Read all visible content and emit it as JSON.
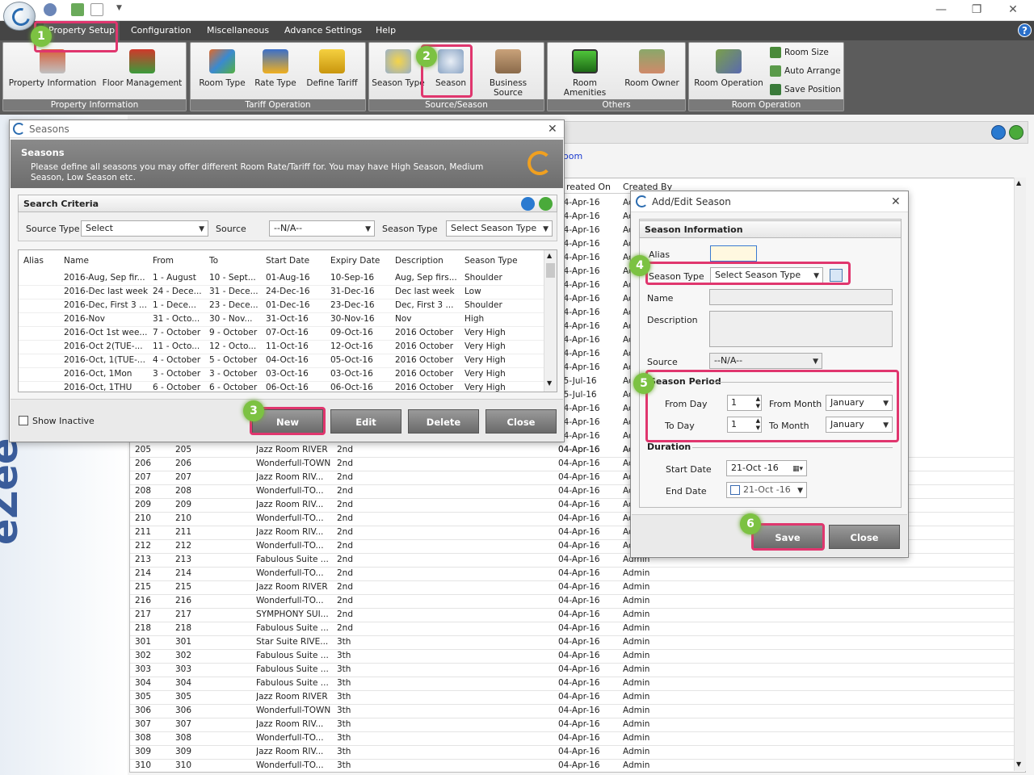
{
  "window": {
    "minimize": "—",
    "restore": "❐",
    "close": "✕",
    "help": "?"
  },
  "menu": [
    "Property Setup",
    "Configuration",
    "Miscellaneous",
    "Advance Settings",
    "Help"
  ],
  "ribbon": {
    "groups": [
      {
        "label": "Property Information",
        "buttons": [
          "Property Information",
          "Floor Management"
        ]
      },
      {
        "label": "Tariff Operation",
        "buttons": [
          "Room Type",
          "Rate Type",
          "Define Tariff"
        ]
      },
      {
        "label": "Source/Season",
        "buttons": [
          "Season Type",
          "Season",
          "Business Source"
        ]
      },
      {
        "label": "Others",
        "buttons": [
          "Room Amenities",
          "Room Owner"
        ]
      },
      {
        "label": "Room Operation",
        "buttons": [
          "Room Operation"
        ],
        "small": [
          "Room Size",
          "Auto Arrange",
          "Save Position"
        ]
      }
    ]
  },
  "brand": "eZee",
  "bg_grid": {
    "link": "oom",
    "headers": [
      "reated On",
      "Created By"
    ],
    "side_rows": [
      {
        "date": "04-Apr-16",
        "by": "Ac"
      },
      {
        "date": "04-Apr-16",
        "by": "Ac"
      },
      {
        "date": "04-Apr-16",
        "by": "Ac"
      },
      {
        "date": "04-Apr-16",
        "by": "Ac"
      },
      {
        "date": "04-Apr-16",
        "by": "Ac"
      },
      {
        "date": "04-Apr-16",
        "by": "Ac"
      },
      {
        "date": "04-Apr-16",
        "by": "Ac"
      },
      {
        "date": "04-Apr-16",
        "by": "Ac"
      },
      {
        "date": "04-Apr-16",
        "by": "Ac"
      },
      {
        "date": "04-Apr-16",
        "by": "Ac"
      },
      {
        "date": "04-Apr-16",
        "by": "Ac"
      },
      {
        "date": "04-Apr-16",
        "by": "Ac"
      },
      {
        "date": "04-Apr-16",
        "by": "Ac"
      },
      {
        "date": "15-Jul-16",
        "by": "Ac"
      },
      {
        "date": "15-Jul-16",
        "by": "Ac"
      },
      {
        "date": "04-Apr-16",
        "by": "Ac"
      },
      {
        "date": "04-Apr-16",
        "by": "Ac"
      },
      {
        "date": "04-Apr-16",
        "by": "Ac"
      },
      {
        "date": "04-Apr-16",
        "by": "Ac"
      }
    ],
    "rows": [
      [
        "205",
        "205",
        "Jazz Room RIVER",
        "2nd",
        "04-Apr-16",
        "Ac"
      ],
      [
        "206",
        "206",
        "Wonderfull-TOWN",
        "2nd",
        "04-Apr-16",
        "Ac"
      ],
      [
        "207",
        "207",
        "Jazz Room RIV...",
        "2nd",
        "04-Apr-16",
        "Ac"
      ],
      [
        "208",
        "208",
        "Wonderfull-TO...",
        "2nd",
        "04-Apr-16",
        "Ac"
      ],
      [
        "209",
        "209",
        "Jazz Room RIV...",
        "2nd",
        "04-Apr-16",
        "Ac"
      ],
      [
        "210",
        "210",
        "Wonderfull-TO...",
        "2nd",
        "04-Apr-16",
        "Ac"
      ],
      [
        "211",
        "211",
        "Jazz Room RIV...",
        "2nd",
        "04-Apr-16",
        "Ac"
      ],
      [
        "212",
        "212",
        "Wonderfull-TO...",
        "2nd",
        "04-Apr-16",
        "Ac"
      ],
      [
        "213",
        "213",
        "Fabulous Suite ...",
        "2nd",
        "04-Apr-16",
        "Admin"
      ],
      [
        "214",
        "214",
        "Wonderfull-TO...",
        "2nd",
        "04-Apr-16",
        "Admin"
      ],
      [
        "215",
        "215",
        "Jazz Room RIVER",
        "2nd",
        "04-Apr-16",
        "Admin"
      ],
      [
        "216",
        "216",
        "Wonderfull-TO...",
        "2nd",
        "04-Apr-16",
        "Admin"
      ],
      [
        "217",
        "217",
        "SYMPHONY SUI...",
        "2nd",
        "04-Apr-16",
        "Admin"
      ],
      [
        "218",
        "218",
        "Fabulous Suite ...",
        "2nd",
        "04-Apr-16",
        "Admin"
      ],
      [
        "301",
        "301",
        "Star Suite RIVE...",
        "3th",
        "04-Apr-16",
        "Admin"
      ],
      [
        "302",
        "302",
        "Fabulous Suite ...",
        "3th",
        "04-Apr-16",
        "Admin"
      ],
      [
        "303",
        "303",
        "Fabulous Suite ...",
        "3th",
        "04-Apr-16",
        "Admin"
      ],
      [
        "304",
        "304",
        "Fabulous Suite ...",
        "3th",
        "04-Apr-16",
        "Admin"
      ],
      [
        "305",
        "305",
        "Jazz Room RIVER",
        "3th",
        "04-Apr-16",
        "Admin"
      ],
      [
        "306",
        "306",
        "Wonderfull-TOWN",
        "3th",
        "04-Apr-16",
        "Admin"
      ],
      [
        "307",
        "307",
        "Jazz Room RIV...",
        "3th",
        "04-Apr-16",
        "Admin"
      ],
      [
        "308",
        "308",
        "Wonderfull-TO...",
        "3th",
        "04-Apr-16",
        "Admin"
      ],
      [
        "309",
        "309",
        "Jazz Room RIV...",
        "3th",
        "04-Apr-16",
        "Admin"
      ],
      [
        "310",
        "310",
        "Wonderfull-TO...",
        "3th",
        "04-Apr-16",
        "Admin"
      ]
    ]
  },
  "seasons": {
    "title": "Seasons",
    "heading": "Seasons",
    "desc": "Please define all seasons you may offer different Room Rate/Tariff for. You may have High Season, Medium Season, Low Season etc.",
    "search_title": "Search Criteria",
    "filters": {
      "source_type_label": "Source Type",
      "source_type_value": "Select",
      "source_label": "Source",
      "source_value": "--N/A--",
      "season_type_label": "Season Type",
      "season_type_value": "Select Season Type"
    },
    "columns": [
      "Alias",
      "Name",
      "From",
      "To",
      "Start Date",
      "Expiry Date",
      "Description",
      "Season Type"
    ],
    "rows": [
      [
        "",
        "2016-Aug, Sep fir...",
        "1 - August",
        "10 - Sept...",
        "01-Aug-16",
        "10-Sep-16",
        "Aug, Sep firs...",
        "Shoulder"
      ],
      [
        "",
        "2016-Dec last week",
        "24 - Dece...",
        "31 - Dece...",
        "24-Dec-16",
        "31-Dec-16",
        "Dec last week",
        "Low"
      ],
      [
        "",
        "2016-Dec, First 3 ...",
        "1 - Dece...",
        "23 - Dece...",
        "01-Dec-16",
        "23-Dec-16",
        "Dec, First 3 ...",
        "Shoulder"
      ],
      [
        "",
        "2016-Nov",
        "31 - Octo...",
        "30 - Nov...",
        "31-Oct-16",
        "30-Nov-16",
        "Nov",
        "High"
      ],
      [
        "",
        "2016-Oct 1st wee...",
        "7 - October",
        "9 - October",
        "07-Oct-16",
        "09-Oct-16",
        "2016 October",
        "Very High"
      ],
      [
        "",
        "2016-Oct 2(TUE-...",
        "11 - Octo...",
        "12 - Octo...",
        "11-Oct-16",
        "12-Oct-16",
        "2016 October",
        "Very High"
      ],
      [
        "",
        "2016-Oct, 1(TUE-...",
        "4 - October",
        "5 - October",
        "04-Oct-16",
        "05-Oct-16",
        "2016 October",
        "Very High"
      ],
      [
        "",
        "2016-Oct, 1Mon",
        "3 - October",
        "3 - October",
        "03-Oct-16",
        "03-Oct-16",
        "2016 October",
        "Very High"
      ],
      [
        "",
        "2016-Oct, 1THU",
        "6 - October",
        "6 - October",
        "06-Oct-16",
        "06-Oct-16",
        "2016 October",
        "Very High"
      ]
    ],
    "show_inactive": "Show Inactive",
    "buttons": {
      "new": "New",
      "edit": "Edit",
      "delete": "Delete",
      "close": "Close"
    }
  },
  "dialog": {
    "title": "Add/Edit Season",
    "section": "Season Information",
    "alias_label": "Alias",
    "season_type_label": "Season Type",
    "season_type_value": "Select Season Type",
    "name_label": "Name",
    "description_label": "Description",
    "source_label": "Source",
    "source_value": "--N/A--",
    "period_label": "Season Period",
    "from_day_label": "From Day",
    "from_day_value": "1",
    "from_month_label": "From Month",
    "from_month_value": "January",
    "to_day_label": "To Day",
    "to_day_value": "1",
    "to_month_label": "To Month",
    "to_month_value": "January",
    "duration_label": "Duration",
    "start_date_label": "Start Date",
    "start_date_value": "21-Oct -16",
    "end_date_label": "End Date",
    "end_date_value": "21-Oct -16",
    "save": "Save",
    "close": "Close"
  },
  "steps": [
    "1",
    "2",
    "3",
    "4",
    "5",
    "6"
  ],
  "colors": {
    "highlight": "#e0366e",
    "badge": "#7cc242",
    "menubar": "#454545"
  }
}
